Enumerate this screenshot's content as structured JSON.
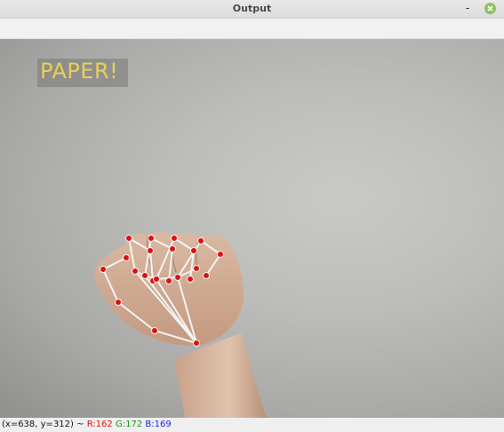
{
  "window": {
    "title": "Output",
    "minimize_symbol": "-",
    "close_icon": "close-icon"
  },
  "frame": {
    "overlay_label": "PAPER!",
    "overlay_label_color": "#e8cf5a",
    "landmark_color": "#dd1111",
    "connection_color": "#f4f4f4"
  },
  "status": {
    "coords": "(x=638, y=312) ~",
    "r": "R:162",
    "g": "G:172",
    "b": "B:169"
  }
}
